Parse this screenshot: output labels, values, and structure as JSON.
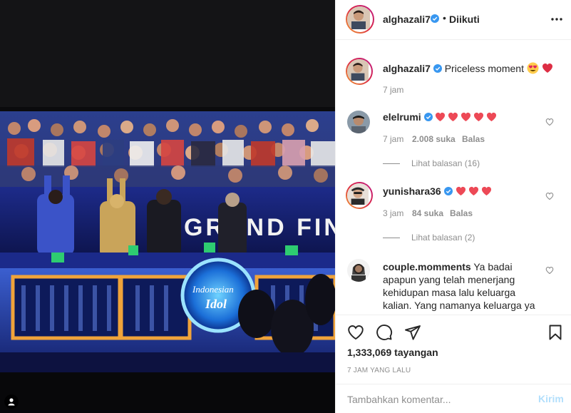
{
  "media": {
    "banner_text": "GRAND FINAL",
    "logo_line1": "Indonesian",
    "logo_line2": "Idol"
  },
  "header": {
    "username": "alghazali7",
    "separator": "•",
    "follow_status": "Diikuti",
    "more_icon": "ellipsis-icon"
  },
  "caption": {
    "username": "alghazali7",
    "text": "Priceless moment",
    "emojis": [
      "heart-eyes-emoji",
      "red-heart-emoji"
    ],
    "time": "7 jam"
  },
  "comments": [
    {
      "username": "elelrumi",
      "verified": true,
      "heart_count": 5,
      "time": "7 jam",
      "likes": "2.008 suka",
      "reply_label": "Balas",
      "view_replies": "Lihat balasan (16)"
    },
    {
      "username": "yunishara36",
      "verified": true,
      "heart_count": 3,
      "time": "3 jam",
      "likes": "84 suka",
      "reply_label": "Balas",
      "view_replies": "Lihat balasan (2)"
    },
    {
      "username": "couple.momments",
      "verified": false,
      "text_line1": "Ya badai",
      "text_line2": "apapun yang telah menerjang",
      "text_line3": "kehidupan masa lalu keluarga",
      "text_line4": "kalian. Yang namanya keluarga ya"
    }
  ],
  "actions": {
    "like_icon": "heart-outline-icon",
    "comment_icon": "comment-bubble-icon",
    "share_icon": "paper-plane-icon",
    "save_icon": "bookmark-icon",
    "views": "1,333,069 tayangan",
    "timestamp": "7 JAM YANG LALU"
  },
  "comment_box": {
    "placeholder": "Tambahkan komentar...",
    "post_label": "Kirim"
  },
  "colors": {
    "verified_blue": "#3897f0",
    "heart_red": "#ed4956",
    "post_button_disabled": "#b2dffc",
    "muted_text": "#8e8e8e"
  }
}
